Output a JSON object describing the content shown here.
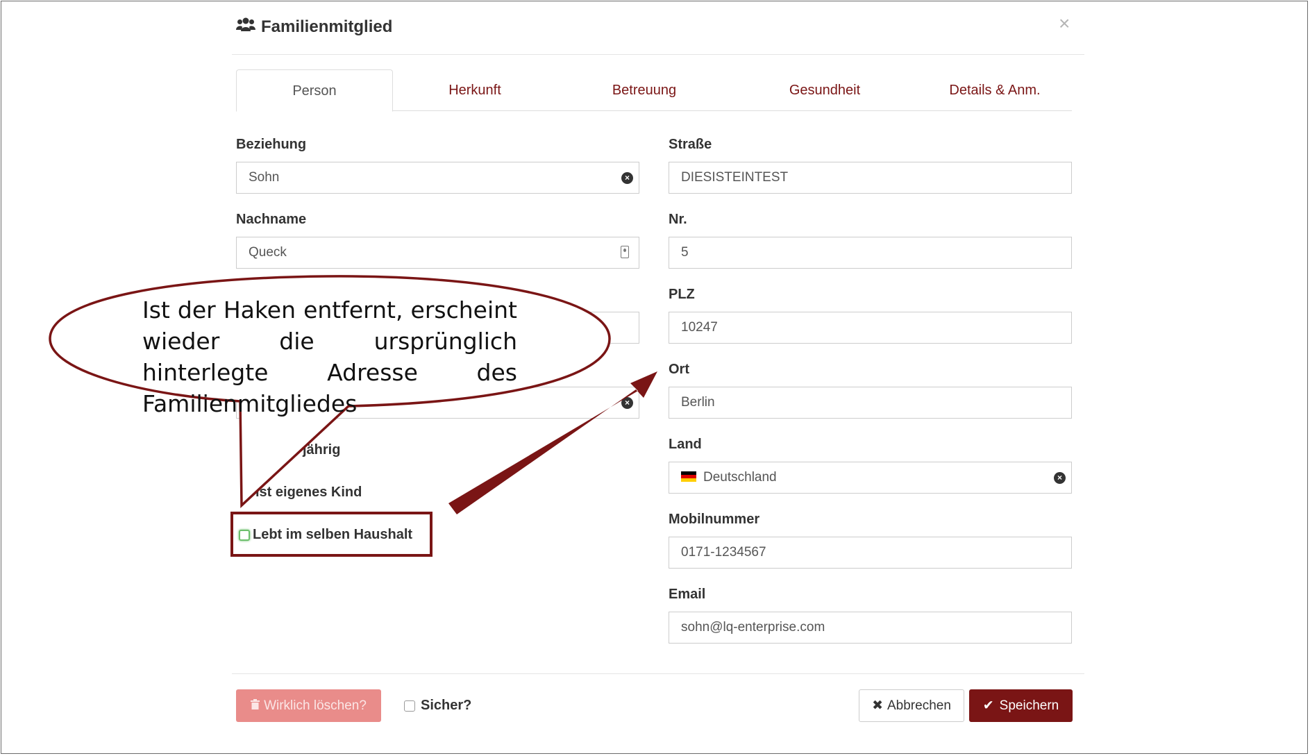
{
  "dialog": {
    "title": "Familienmitglied",
    "close_symbol": "×"
  },
  "tabs": [
    {
      "label": "Person"
    },
    {
      "label": "Herkunft"
    },
    {
      "label": "Betreuung"
    },
    {
      "label": "Gesundheit"
    },
    {
      "label": "Details & Anm."
    }
  ],
  "left": {
    "beziehung_label": "Beziehung",
    "beziehung_value": "Sohn",
    "nachname_label": "Nachname",
    "nachname_value": "Queck",
    "volljaehrig_fragment": "jährig",
    "kind_fragment": "ist eigenes Kind",
    "haushalt_label": "Lebt im selben Haushalt"
  },
  "right": {
    "strasse_label": "Straße",
    "strasse_value": "DIESISTEINTEST",
    "nr_label": "Nr.",
    "nr_value": "5",
    "plz_label": "PLZ",
    "plz_value": "10247",
    "ort_label": "Ort",
    "ort_value": "Berlin",
    "land_label": "Land",
    "land_value": "Deutschland",
    "mobil_label": "Mobilnummer",
    "mobil_value": "0171-1234567",
    "email_label": "Email",
    "email_value": "sohn@lq-enterprise.com"
  },
  "footer": {
    "delete_label": "Wirklich löschen?",
    "confirm_label": "Sicher?",
    "cancel_label": "Abbrechen",
    "save_label": "Speichern"
  },
  "annotation": {
    "callout_text": "Ist der Haken entfernt, erscheint wieder die ursprünglich hinterlegte Adresse des Familienmitgliedes"
  },
  "colors": {
    "brand": "#7a1515",
    "delete_button": "#e98c8a",
    "checkbox_focus": "#6cbf6c"
  },
  "icons": {
    "title": "users-icon",
    "clear": "times-circle-icon",
    "contact": "contact-card-icon",
    "delete": "trash-icon",
    "cancel": "times-icon",
    "save": "check-icon",
    "flag": "flag-germany-icon"
  }
}
